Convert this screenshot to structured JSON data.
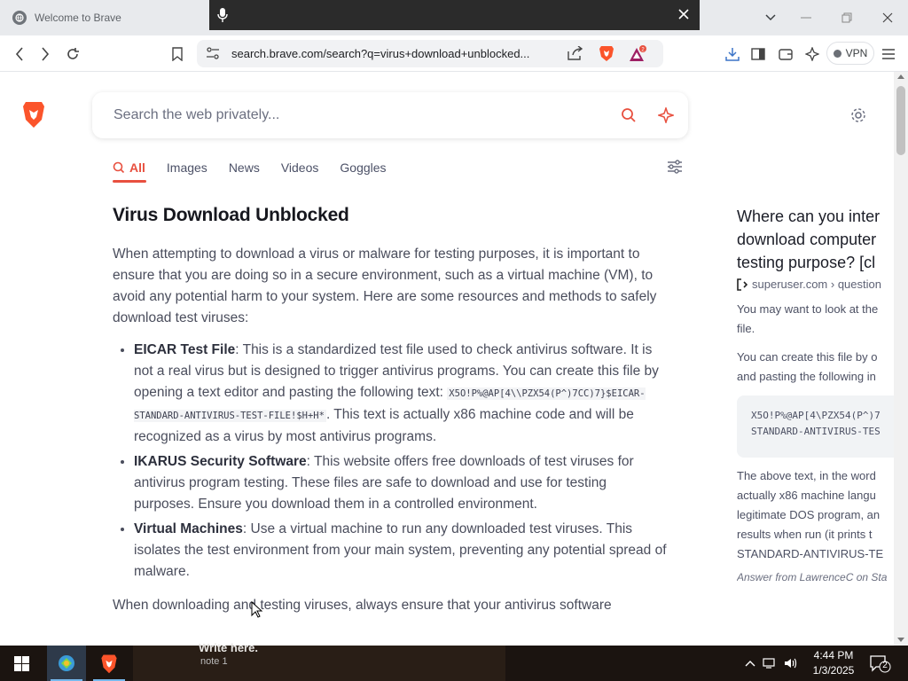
{
  "browser": {
    "tab_title": "Welcome to Brave",
    "url": "search.brave.com/search?q=virus+download+unblocked...",
    "vpn_label": "VPN",
    "notification_count": "2"
  },
  "search": {
    "placeholder": "Search the web privately...",
    "tabs": [
      "All",
      "Images",
      "News",
      "Videos",
      "Goggles"
    ]
  },
  "main": {
    "title": "Virus Download Unblocked",
    "intro": "When attempting to download a virus or malware for testing purposes, it is important to ensure that you are doing so in a secure environment, such as a virtual machine (VM), to avoid any potential harm to your system. Here are some resources and methods to safely download test viruses:",
    "items": [
      {
        "term": "EICAR Test File",
        "text_before": ": This is a standardized test file used to check antivirus software. It is not a real virus but is designed to trigger antivirus programs. You can create this file by opening a text editor and pasting the following text: ",
        "code": "X5O!P%@AP[4\\\\PZX54(P^)7CC)7}$EICAR-STANDARD-ANTIVIRUS-TEST-FILE!$H+H*",
        "text_after": ". This text is actually x86 machine code and will be recognized as a virus by most antivirus programs."
      },
      {
        "term": "IKARUS Security Software",
        "text_before": ": This website offers free downloads of test viruses for antivirus program testing. These files are safe to download and use for testing purposes. Ensure you download them in a controlled environment.",
        "code": "",
        "text_after": ""
      },
      {
        "term": "Virtual Machines",
        "text_before": ": Use a virtual machine to run any downloaded test viruses. This isolates the test environment from your main system, preventing any potential spread of malware.",
        "code": "",
        "text_after": ""
      }
    ],
    "outro": "When downloading and testing viruses, always ensure that your antivirus software"
  },
  "side": {
    "question_lines": [
      "Where can you inter",
      "download computer",
      "testing purpose? [cl"
    ],
    "source": "superuser.com › question",
    "para1_lines": [
      "You may want to look at the",
      "file."
    ],
    "para2_lines": [
      "You can create this file by o",
      "and pasting the following in"
    ],
    "code_lines": [
      "X5O!P%@AP[4\\PZX54(P^)7",
      "STANDARD-ANTIVIRUS-TES"
    ],
    "para3_lines": [
      "The above text, in the word",
      "actually x86 machine langu",
      "legitimate DOS program, an",
      "results when run (it prints t",
      "STANDARD-ANTIVIRUS-TE"
    ],
    "answer_credit": "Answer from LawrenceC on Sta"
  },
  "taskbar": {
    "time": "4:44 PM",
    "date": "1/3/2025",
    "bg_title": "Write here.",
    "bg_sub": "note 1"
  },
  "colors": {
    "accent": "#e8503f",
    "brave_orange": "#fb542b"
  }
}
